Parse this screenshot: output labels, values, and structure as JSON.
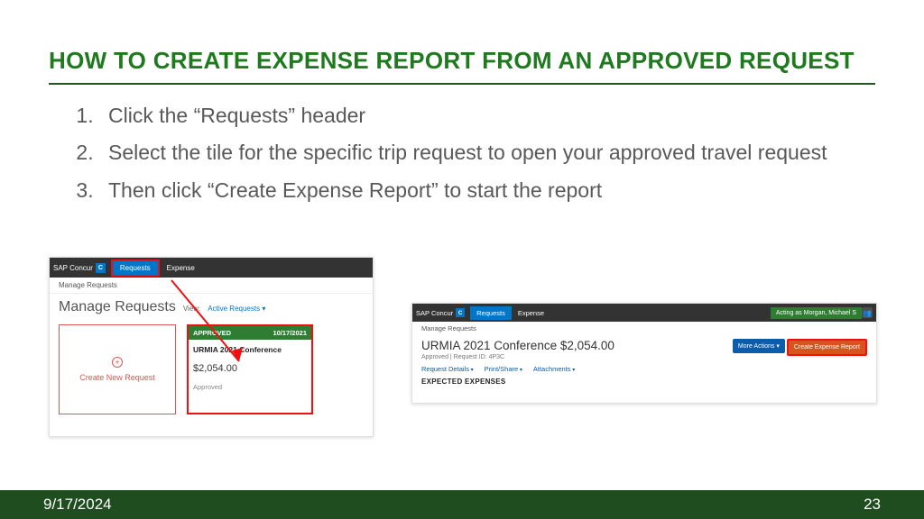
{
  "title": "HOW TO CREATE EXPENSE REPORT FROM AN APPROVED REQUEST",
  "steps": [
    "Click the “Requests” header",
    "Select the tile for the specific trip request to open your approved travel request",
    "Then click “Create Expense Report” to start the report"
  ],
  "ss1": {
    "brand": "SAP Concur",
    "logo_initial": "C",
    "tab_requests": "Requests",
    "tab_expense": "Expense",
    "breadcrumb": "Manage Requests",
    "heading": "Manage Requests",
    "view_label": "View:",
    "view_value": "Active Requests",
    "new_tile": "Create New Request",
    "req": {
      "status": "APPROVED",
      "date": "10/17/2021",
      "name": "URMIA 2021 Conference",
      "amount": "$2,054.00",
      "state": "Approved"
    }
  },
  "ss2": {
    "brand": "SAP Concur",
    "logo_initial": "C",
    "tab_requests": "Requests",
    "tab_expense": "Expense",
    "acting_as": "Acting as Morgan, Michael S",
    "breadcrumb": "Manage Requests",
    "title_line": "URMIA 2021 Conference $2,054.00",
    "meta": "Approved  |  Request ID: 4P3C",
    "btn_more": "More Actions ▾",
    "btn_create": "Create Expense Report",
    "links": [
      "Request Details",
      "Print/Share",
      "Attachments"
    ],
    "section": "EXPECTED EXPENSES"
  },
  "footer": {
    "date": "9/17/2024",
    "page": "23"
  }
}
